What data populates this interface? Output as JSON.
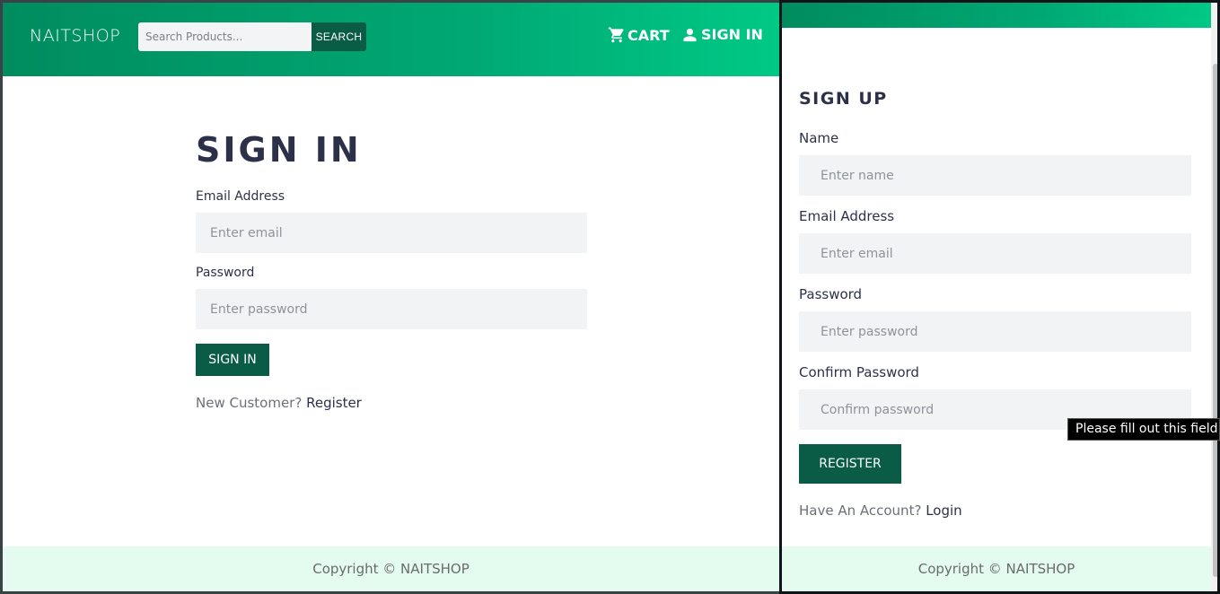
{
  "header": {
    "brand": "NAITSHOP",
    "search_placeholder": "Search Products...",
    "search_button": "SEARCH",
    "cart_label": "CART",
    "signin_label": "SIGN IN"
  },
  "signin": {
    "title": "SIGN IN",
    "email_label": "Email Address",
    "email_placeholder": "Enter email",
    "password_label": "Password",
    "password_placeholder": "Enter password",
    "submit_label": "SIGN IN",
    "new_customer_text": "New Customer?",
    "register_link": "Register"
  },
  "signup": {
    "title": "SIGN UP",
    "name_label": "Name",
    "name_placeholder": "Enter name",
    "email_label": "Email Address",
    "email_placeholder": "Enter email",
    "password_label": "Password",
    "password_placeholder": "Enter password",
    "confirm_label": "Confirm Password",
    "confirm_placeholder": "Confirm password",
    "submit_label": "REGISTER",
    "have_account_text": "Have An Account?",
    "login_link": "Login"
  },
  "footer": {
    "copyright": "Copyright © NAITSHOP"
  },
  "tooltip": {
    "text": "Please fill out this field."
  },
  "colors": {
    "brand_green": "#00a873",
    "button_dark_green": "#0a5c47",
    "footer_bg": "#e3fcef",
    "heading": "#2c3149"
  },
  "icons": {
    "cart": "cart-icon",
    "user": "user-icon"
  }
}
